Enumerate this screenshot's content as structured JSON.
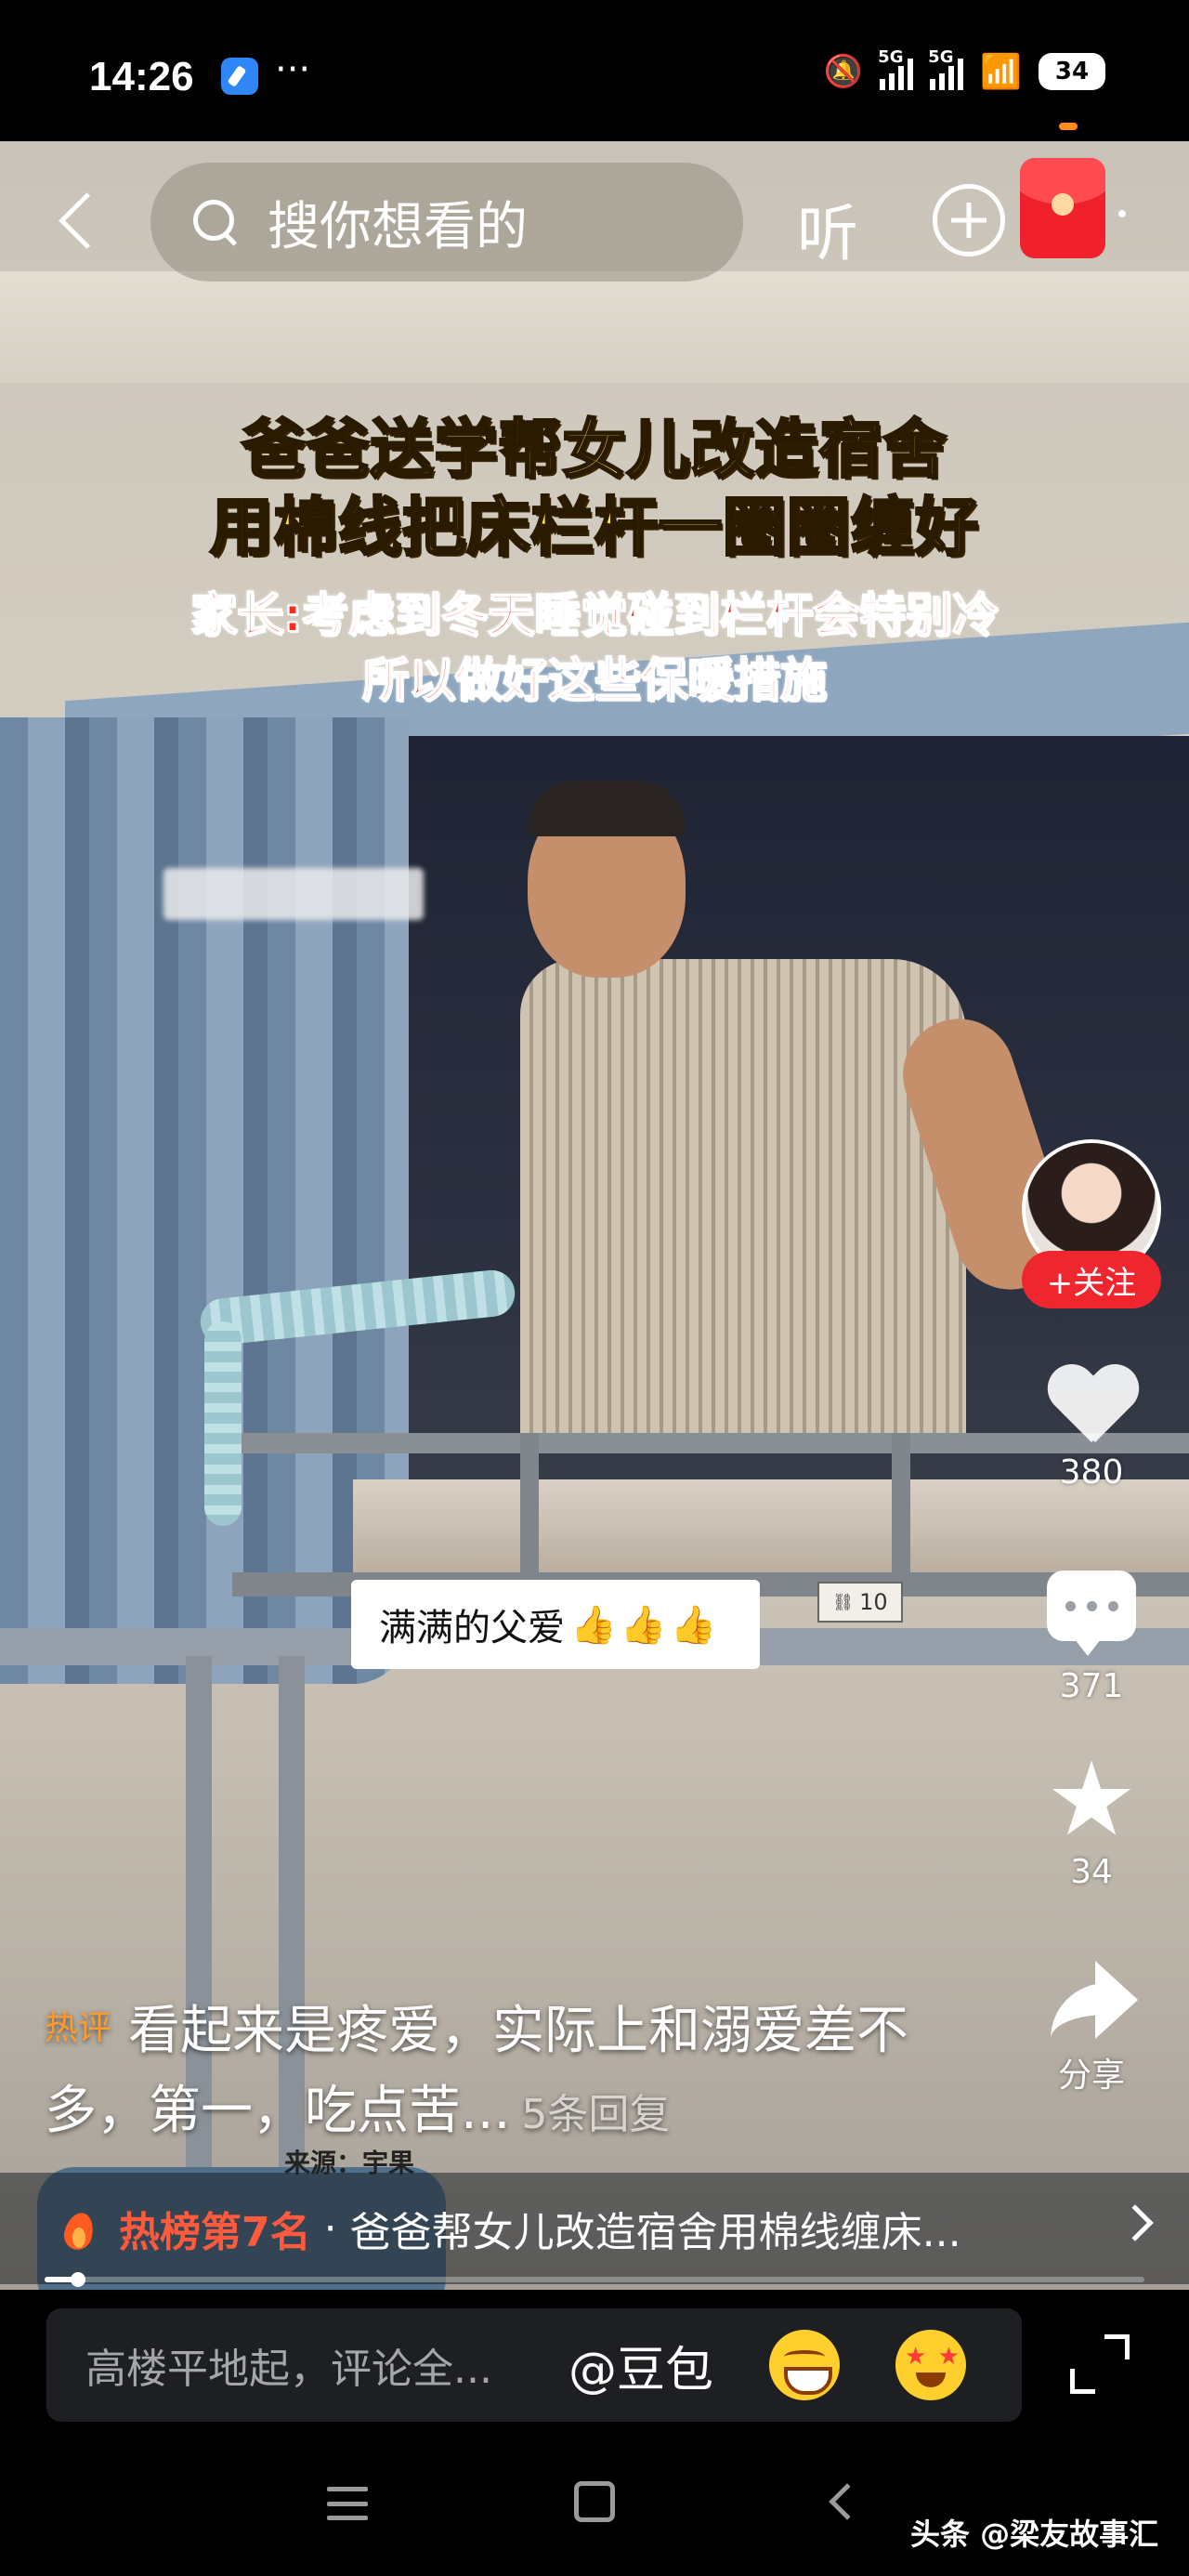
{
  "status_bar": {
    "time": "14:26",
    "dots": "···",
    "signal1": "5G",
    "signal2": "5G",
    "battery": "34"
  },
  "top_nav": {
    "search_placeholder": "搜你想看的",
    "listen_label": "听"
  },
  "video": {
    "title_line1": "爸爸送学帮女儿改造宿舍",
    "title_line2": "用棉线把床栏杆一圈圈缠好",
    "subtitle_line1": "家长:考虑到冬天睡觉碰到栏杆会特别冷",
    "subtitle_line2": "所以做好这些保暖措施",
    "sticker_text": "满满的父爱",
    "sticker_emoji": "👍👍👍",
    "bed_tag": "10",
    "source": "来源：宇果"
  },
  "right_rail": {
    "follow_label": "+关注",
    "likes": "380",
    "comments": "371",
    "favorites": "34",
    "share_label": "分享"
  },
  "hot_comment": {
    "tag": "热评",
    "text": "看起来是疼爱，实际上和溺爱差不多，第一，吃点苦...",
    "replies": "5条回复"
  },
  "trending": {
    "rank": "热榜第7名",
    "separator": "·",
    "title": "爸爸帮女儿改造宿舍用棉线缠床..."
  },
  "progress": {
    "fraction": 0.03
  },
  "comment_bar": {
    "placeholder": "高楼平地起，评论全...",
    "at_label": "@豆包"
  },
  "watermark": "头条 @梁友故事汇",
  "colors": {
    "accent_red": "#f0262f",
    "hot_orange": "#ff9a2e",
    "caption_yellow": "#ffe838",
    "caption_red": "#ff2a1e"
  }
}
